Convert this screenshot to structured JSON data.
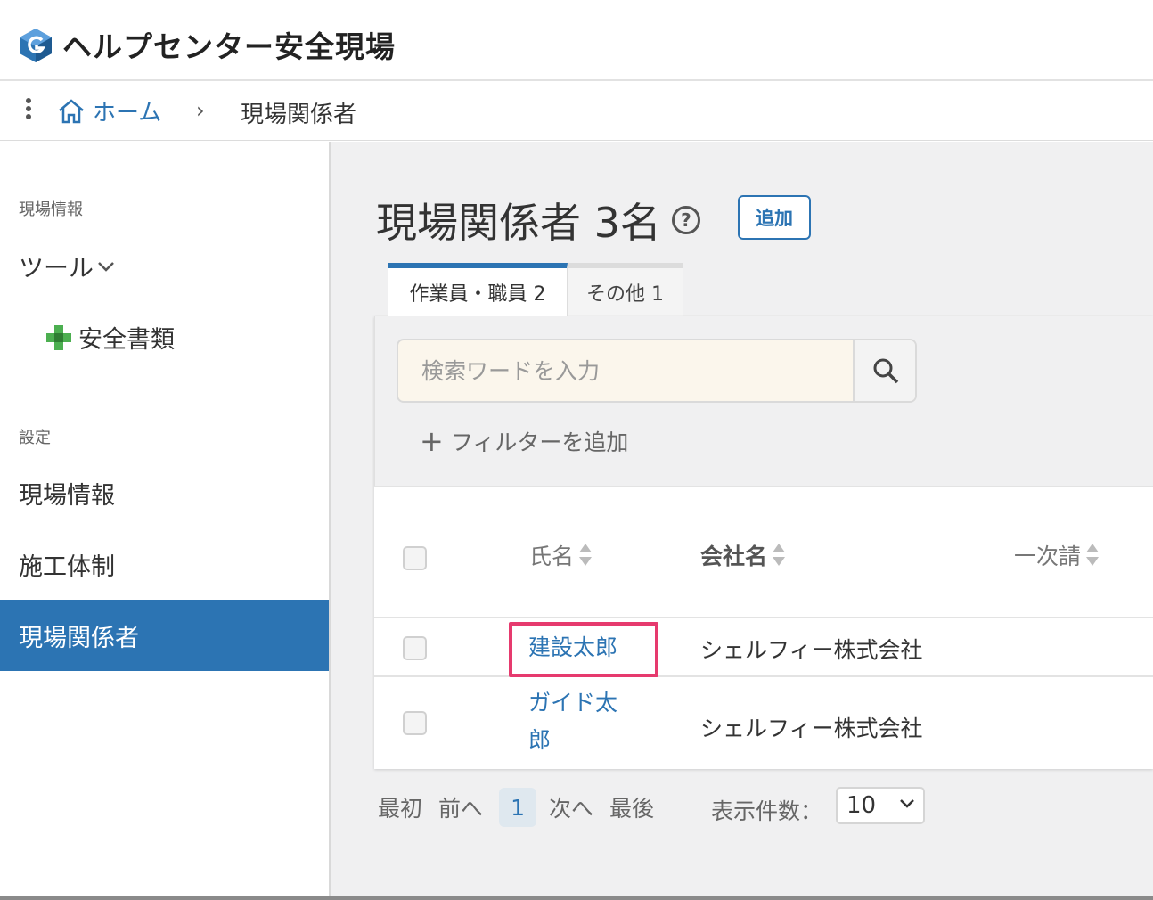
{
  "header": {
    "title": "ヘルプセンター安全現場",
    "logo": "g-cube-logo"
  },
  "breadcrumb": {
    "home": "ホーム",
    "separator": "›",
    "current": "現場関係者"
  },
  "sidebar": {
    "section_site": "現場情報",
    "tools": "ツール",
    "safety_docs": "安全書類",
    "section_settings": "設定",
    "items": [
      {
        "label": "現場情報",
        "active": false
      },
      {
        "label": "施工体制",
        "active": false
      },
      {
        "label": "現場関係者",
        "active": true
      }
    ]
  },
  "main": {
    "title": "現場関係者 3名",
    "help": "?",
    "add_button": "追加",
    "tabs": [
      {
        "label": "作業員・職員 2",
        "active": true
      },
      {
        "label": "その他 1",
        "active": false
      }
    ],
    "search": {
      "placeholder": "検索ワードを入力",
      "value": ""
    },
    "add_filter": "フィルターを追加",
    "add_filter_plus": "+",
    "table": {
      "columns": [
        "氏名",
        "会社名",
        "一次請"
      ],
      "rows": [
        {
          "name": "建設太郎",
          "company": "シェルフィー株式会社"
        },
        {
          "name_line1": "ガイド太",
          "name_line2": "郎",
          "company": "シェルフィー株式会社"
        }
      ]
    },
    "pagination": {
      "first": "最初",
      "prev": "前へ",
      "current": "1",
      "next": "次へ",
      "last": "最後",
      "per_page_label": "表示件数：",
      "per_page_value": "10"
    }
  },
  "colors": {
    "accent": "#2c74b3",
    "highlight": "#e63a6e",
    "background": "#f0f0f1"
  }
}
